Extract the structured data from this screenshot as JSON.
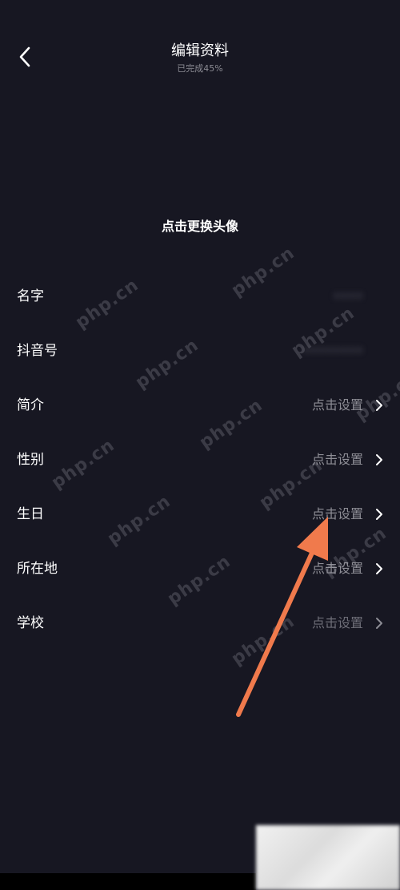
{
  "header": {
    "title": "编辑资料",
    "subtitle": "已完成45%"
  },
  "avatar": {
    "change_label": "点击更换头像"
  },
  "rows": [
    {
      "label": "名字",
      "value": "••••"
    },
    {
      "label": "抖音号",
      "value": "••••••••"
    },
    {
      "label": "简介",
      "value": "点击设置"
    },
    {
      "label": "性别",
      "value": "点击设置"
    },
    {
      "label": "生日",
      "value": "点击设置"
    },
    {
      "label": "所在地",
      "value": "点击设置"
    },
    {
      "label": "学校",
      "value": "点击设置"
    }
  ],
  "watermark": {
    "text": "php.cn"
  },
  "colors": {
    "background": "#171722",
    "primary_text": "#ffffff",
    "secondary_text": "#8d8d95",
    "arrow": "#f07a4c"
  },
  "icons": {
    "back": "chevron-left-icon",
    "row_arrow": "chevron-right-icon"
  }
}
